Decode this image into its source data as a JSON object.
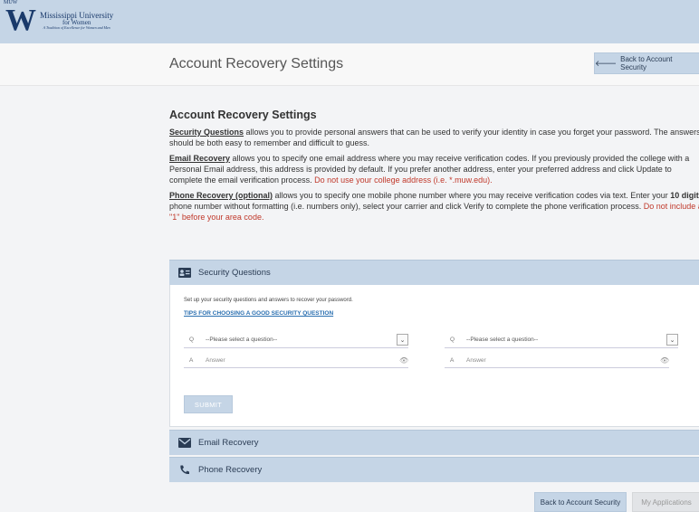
{
  "logo": {
    "mark": "W",
    "mark_small": "MUW",
    "line1": "Mississippi University",
    "line2": "for Women",
    "tagline": "A Tradition of Excellence for Women and Men"
  },
  "header": {
    "title": "Account Recovery Settings",
    "back_button": "Back to Account Security"
  },
  "intro": {
    "title": "Account Recovery Settings",
    "security_label": "Security Questions",
    "security_text": " allows you to provide personal answers that can be used to verify your identity in case you forget your password. The answers should be both easy to remember and difficult to guess.",
    "email_label": "Email Recovery",
    "email_text": " allows you to specify one email address where you may receive verification codes. If you previously provided the college with a Personal Email address, this address is provided by default.  If you prefer another address, enter your preferred address and click Update to complete the email verification process. ",
    "email_warning": "Do not use your college address (i.e. *.muw.edu).",
    "phone_label": "Phone Recovery (optional)",
    "phone_text_1": " allows you to specify one mobile phone number where you may receive verification codes via text. Enter your ",
    "phone_bold": "10 digit",
    "phone_text_2": " phone number without formatting (i.e. numbers only), select your carrier and click Verify to complete the phone verification process. ",
    "phone_warning": "Do not include a \"1\" before your area code."
  },
  "security_questions": {
    "heading": "Security Questions",
    "instructions": "Set up your security questions and answers to recover your password.",
    "tips_link": "TIPS FOR CHOOSING A GOOD SECURITY QUESTION",
    "question_label": "Q",
    "answer_label": "A",
    "question_placeholder": "--Please select a question--",
    "answer_placeholder": "Answer",
    "submit": "SUBMIT"
  },
  "email_recovery": {
    "heading": "Email Recovery"
  },
  "phone_recovery": {
    "heading": "Phone Recovery"
  },
  "footer": {
    "back_button": "Back to Account Security",
    "apps_button": "My Applications"
  },
  "colors": {
    "accent": "#c5d5e6",
    "accent_text": "#2b3d55",
    "warning": "#c0392b",
    "link": "#2a6fb0"
  },
  "icons": {
    "back": "arrow-left-icon",
    "security": "id-card-icon",
    "email": "envelope-icon",
    "phone": "phone-icon",
    "dropdown": "chevron-down-icon",
    "reveal": "eye-icon"
  }
}
